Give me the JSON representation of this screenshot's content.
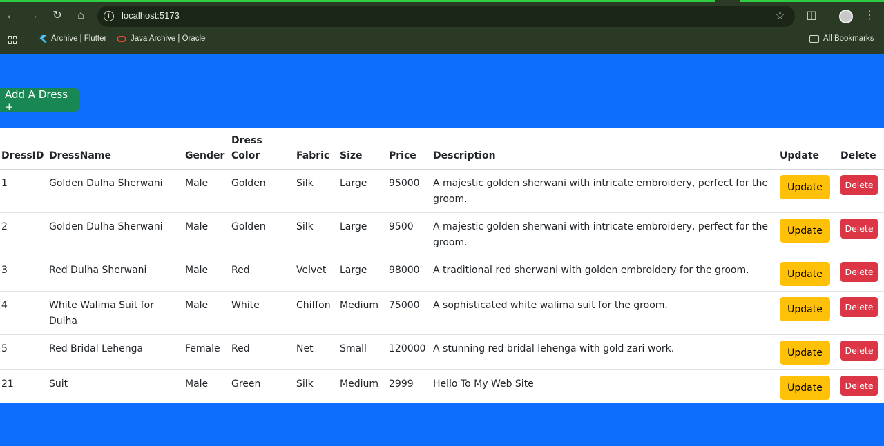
{
  "browser": {
    "url": "localhost:5173",
    "bookmarks": [
      {
        "label": "Archive | Flutter",
        "icon": "flutter-icon"
      },
      {
        "label": "Java Archive | Oracle",
        "icon": "oracle-icon"
      }
    ],
    "all_bookmarks": "All Bookmarks"
  },
  "page": {
    "add_button": "Add A Dress +",
    "columns": [
      "DressID",
      "DressName",
      "Gender",
      "Dress Color",
      "Fabric",
      "Size",
      "Price",
      "Description",
      "Update",
      "Delete"
    ],
    "column_header_color_line1": "Dress",
    "column_header_color_line2": "Color",
    "update_label": "Update",
    "delete_label": "Delete",
    "rows": [
      {
        "id": "1",
        "name": "Golden Dulha Sherwani",
        "gender": "Male",
        "color": "Golden",
        "fabric": "Silk",
        "size": "Large",
        "price": "95000",
        "description": "A majestic golden sherwani with intricate embroidery, perfect for the groom."
      },
      {
        "id": "2",
        "name": "Golden Dulha Sherwani",
        "gender": "Male",
        "color": "Golden",
        "fabric": "Silk",
        "size": "Large",
        "price": "9500",
        "description": "A majestic golden sherwani with intricate embroidery, perfect for the groom."
      },
      {
        "id": "3",
        "name": "Red Dulha Sherwani",
        "gender": "Male",
        "color": "Red",
        "fabric": "Velvet",
        "size": "Large",
        "price": "98000",
        "description": "A traditional red sherwani with golden embroidery for the groom."
      },
      {
        "id": "4",
        "name": "White Walima Suit for Dulha",
        "gender": "Male",
        "color": "White",
        "fabric": "Chiffon",
        "size": "Medium",
        "price": "75000",
        "description": "A sophisticated white walima suit for the groom."
      },
      {
        "id": "5",
        "name": "Red Bridal Lehenga",
        "gender": "Female",
        "color": "Red",
        "fabric": "Net",
        "size": "Small",
        "price": "120000",
        "description": "A stunning red bridal lehenga with gold zari work."
      },
      {
        "id": "21",
        "name": "Suit",
        "gender": "Male",
        "color": "Green",
        "fabric": "Silk",
        "size": "Medium",
        "price": "2999",
        "description": "Hello To My Web Site"
      }
    ]
  },
  "colors": {
    "page_bg": "#0d6efd",
    "add_button": "#198754",
    "update_button": "#ffc107",
    "delete_button": "#dc3545",
    "chrome_bg": "#2b3a25"
  }
}
